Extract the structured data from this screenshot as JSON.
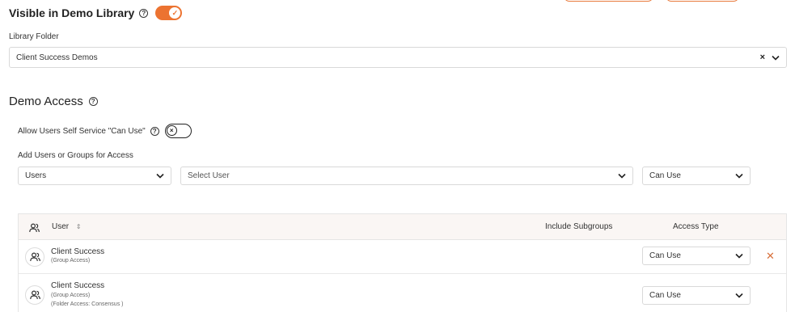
{
  "header": {
    "title": "Visible in Demo Library",
    "toggle_on": true
  },
  "library_folder": {
    "label": "Library Folder",
    "value": "Client Success Demos"
  },
  "demo_access": {
    "title": "Demo Access",
    "self_service_label": "Allow Users Self Service \"Can Use\"",
    "self_service_on": false,
    "add_label": "Add Users or Groups for Access",
    "type_select": "Users",
    "user_select_placeholder": "Select User",
    "access_select": "Can Use"
  },
  "table": {
    "columns": {
      "user": "User",
      "include_subgroups": "Include Subgroups",
      "access_type": "Access Type"
    },
    "rows": [
      {
        "name": "Client Success",
        "sub1": "(Group Access)",
        "sub2": "",
        "access": "Can Use",
        "removable": true
      },
      {
        "name": "Client Success",
        "sub1": "(Group Access)",
        "sub2": "(Folder Access: Consensus )",
        "access": "Can Use",
        "removable": false
      }
    ]
  },
  "colors": {
    "accent": "#ec7331",
    "remove": "#d8703a"
  }
}
